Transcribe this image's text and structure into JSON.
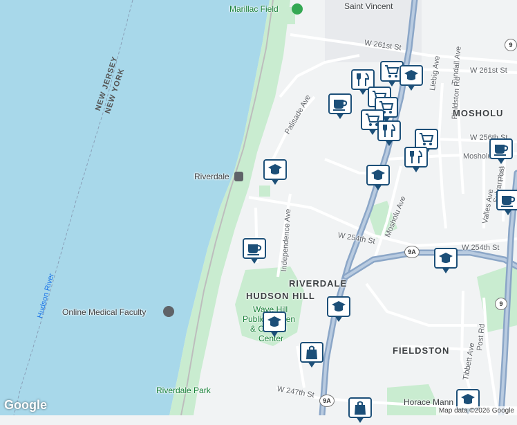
{
  "map": {
    "colors": {
      "water": "#a8d8ea",
      "land": "#f1f3f4",
      "park": "#c9ecd0",
      "highway": "#8ba6c7",
      "road": "#ffffff",
      "marker_border": "#1c4f78"
    },
    "places": {
      "marillac_field": "Marillac Field",
      "saint_vincent": "Saint Vincent",
      "riverdale_station": "Riverdale",
      "riverdale_nbhd": "RIVERDALE",
      "hudson_hill": "HUDSON HILL",
      "wave_hill_1": "Wave Hill",
      "wave_hill_2": "Public Garden",
      "wave_hill_3": "& Cultural",
      "wave_hill_4": "Center",
      "online_medical": "Online Medical Faculty",
      "fieldston": "FIELDSTON",
      "mosholu": "MOSHOLU",
      "riverdale_park": "Riverdale Park",
      "horace_mann": "Horace Mann Sch",
      "hudson_river": "Hudson River",
      "new_jersey": "NEW JERSEY",
      "new_york": "NEW YORK"
    },
    "streets": {
      "w261_a": "W 261st St",
      "w261_b": "W 261st St",
      "palisade": "Palisade Ave",
      "liebig": "Liebig Ave",
      "tyndall": "Tyndall Ave",
      "fieldston_rd": "Fieldston Rd",
      "w256": "W 256th St",
      "mosholu_short": "Mosholu",
      "w254_a": "W 254th St",
      "w254_b": "W 254th St",
      "independence": "Independence Ave",
      "mosholu_ave": "Mosholu Ave",
      "valles": "Valles Ave",
      "sylvan": "Sylvan Ave",
      "post_a": "Post",
      "post_rd": "Post Rd",
      "tibbett": "Tibbett Ave",
      "w247": "W 247th St"
    },
    "shields": {
      "r9_a": "9",
      "r9_b": "9",
      "r9a_a": "9A",
      "r9a_b": "9A"
    },
    "markers": [
      {
        "icon": "restaurant",
        "label": "restaurant-marker"
      },
      {
        "icon": "grocery",
        "label": "grocery-marker"
      },
      {
        "icon": "school",
        "label": "school-marker"
      },
      {
        "icon": "cafe",
        "label": "cafe-marker"
      },
      {
        "icon": "shopping",
        "label": "shopping-marker"
      }
    ]
  },
  "footer": {
    "logo": "Google",
    "attribution": "Map data ©2026 Google"
  }
}
